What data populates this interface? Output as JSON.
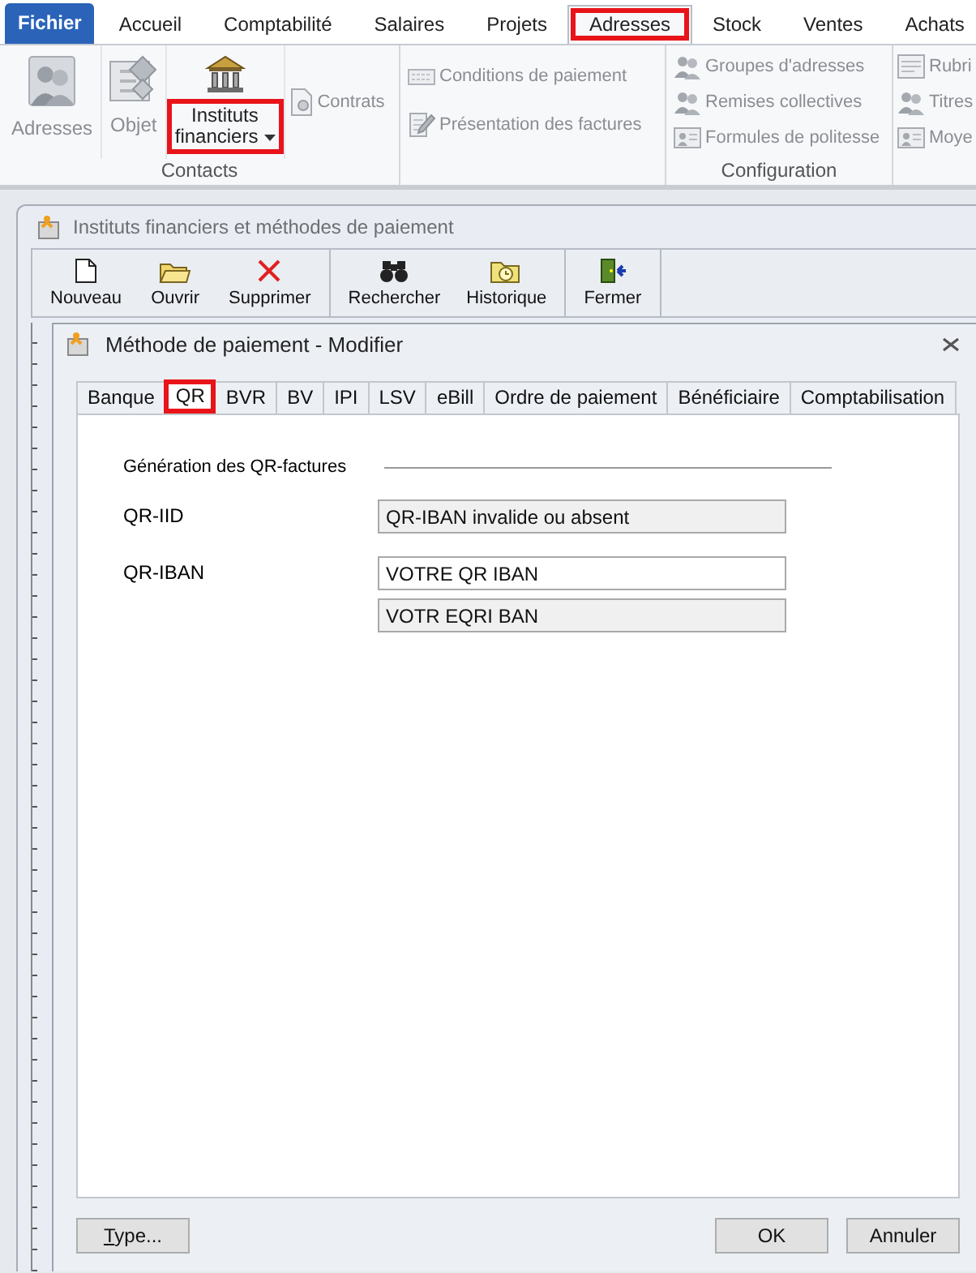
{
  "ribbon_tabs": [
    {
      "label": "Fichier",
      "kind": "file",
      "selected": false,
      "highlighted": false
    },
    {
      "label": "Accueil",
      "kind": "tab",
      "selected": false,
      "highlighted": false
    },
    {
      "label": "Comptabilité",
      "kind": "tab",
      "selected": false,
      "highlighted": false
    },
    {
      "label": "Salaires",
      "kind": "tab",
      "selected": false,
      "highlighted": false
    },
    {
      "label": "Projets",
      "kind": "tab",
      "selected": false,
      "highlighted": false
    },
    {
      "label": "Adresses",
      "kind": "tab",
      "selected": true,
      "highlighted": true
    },
    {
      "label": "Stock",
      "kind": "tab",
      "selected": false,
      "highlighted": false
    },
    {
      "label": "Ventes",
      "kind": "tab",
      "selected": false,
      "highlighted": false
    },
    {
      "label": "Achats",
      "kind": "tab",
      "selected": false,
      "highlighted": false
    }
  ],
  "ribbon_groups": [
    {
      "label": "Contacts",
      "items": [
        {
          "label": "Adresses",
          "kind": "large",
          "disabled": true,
          "highlighted": false,
          "dropdown": false
        },
        {
          "label": "Objet",
          "kind": "large",
          "disabled": true,
          "highlighted": false,
          "dropdown": false
        },
        {
          "label": "Instituts financiers",
          "kind": "large",
          "disabled": false,
          "highlighted": true,
          "dropdown": true
        },
        {
          "label": "Contrats",
          "kind": "small",
          "disabled": true,
          "highlighted": false
        }
      ]
    },
    {
      "items": [
        {
          "label": "Conditions de paiement",
          "kind": "small",
          "disabled": true,
          "highlighted": false
        },
        {
          "label": "Présentation des factures",
          "kind": "small",
          "disabled": true,
          "highlighted": false
        }
      ]
    },
    {
      "label": "Configuration",
      "items": [
        {
          "label": "Groupes d'adresses",
          "kind": "small",
          "disabled": true,
          "highlighted": false
        },
        {
          "label": "Remises collectives",
          "kind": "small",
          "disabled": true,
          "highlighted": false
        },
        {
          "label": "Formules de politesse",
          "kind": "small",
          "disabled": true,
          "highlighted": false
        }
      ]
    },
    {
      "items": [
        {
          "label": "Rubri",
          "kind": "small",
          "disabled": true,
          "highlighted": false
        },
        {
          "label": "Titres",
          "kind": "small",
          "disabled": true,
          "highlighted": false
        },
        {
          "label": "Moye",
          "kind": "small",
          "disabled": true,
          "highlighted": false
        }
      ]
    }
  ],
  "window": {
    "title": "Instituts financiers et méthodes de paiement",
    "toolbar": [
      [
        "Nouveau",
        "Ouvrir",
        "Supprimer"
      ],
      [
        "Rechercher",
        "Historique"
      ],
      [
        "Fermer"
      ]
    ]
  },
  "dialog": {
    "title": "Méthode de paiement - Modifier",
    "tabs": [
      {
        "label": "Banque",
        "selected": false,
        "highlighted": false
      },
      {
        "label": "QR",
        "selected": true,
        "highlighted": true
      },
      {
        "label": "BVR",
        "selected": false,
        "highlighted": false
      },
      {
        "label": "BV",
        "selected": false,
        "highlighted": false
      },
      {
        "label": "IPI",
        "selected": false,
        "highlighted": false
      },
      {
        "label": "LSV",
        "selected": false,
        "highlighted": false
      },
      {
        "label": "eBill",
        "selected": false,
        "highlighted": false
      },
      {
        "label": "Ordre de paiement",
        "selected": false,
        "highlighted": false
      },
      {
        "label": "Bénéficiaire",
        "selected": false,
        "highlighted": false
      },
      {
        "label": "Comptabilisation",
        "selected": false,
        "highlighted": false
      }
    ],
    "section": "Génération des QR-factures",
    "fields": [
      {
        "label": "QR-IID",
        "values": [
          {
            "value": "QR-IBAN invalide ou absent",
            "readonly": true
          }
        ]
      },
      {
        "label": "QR-IBAN",
        "values": [
          {
            "value": "VOTRE QR IBAN",
            "readonly": false
          },
          {
            "value": "VOTR EQRI BAN",
            "readonly": true
          }
        ]
      }
    ],
    "buttons_left": [
      "Type..."
    ],
    "buttons_right": [
      "OK",
      "Annuler"
    ]
  }
}
